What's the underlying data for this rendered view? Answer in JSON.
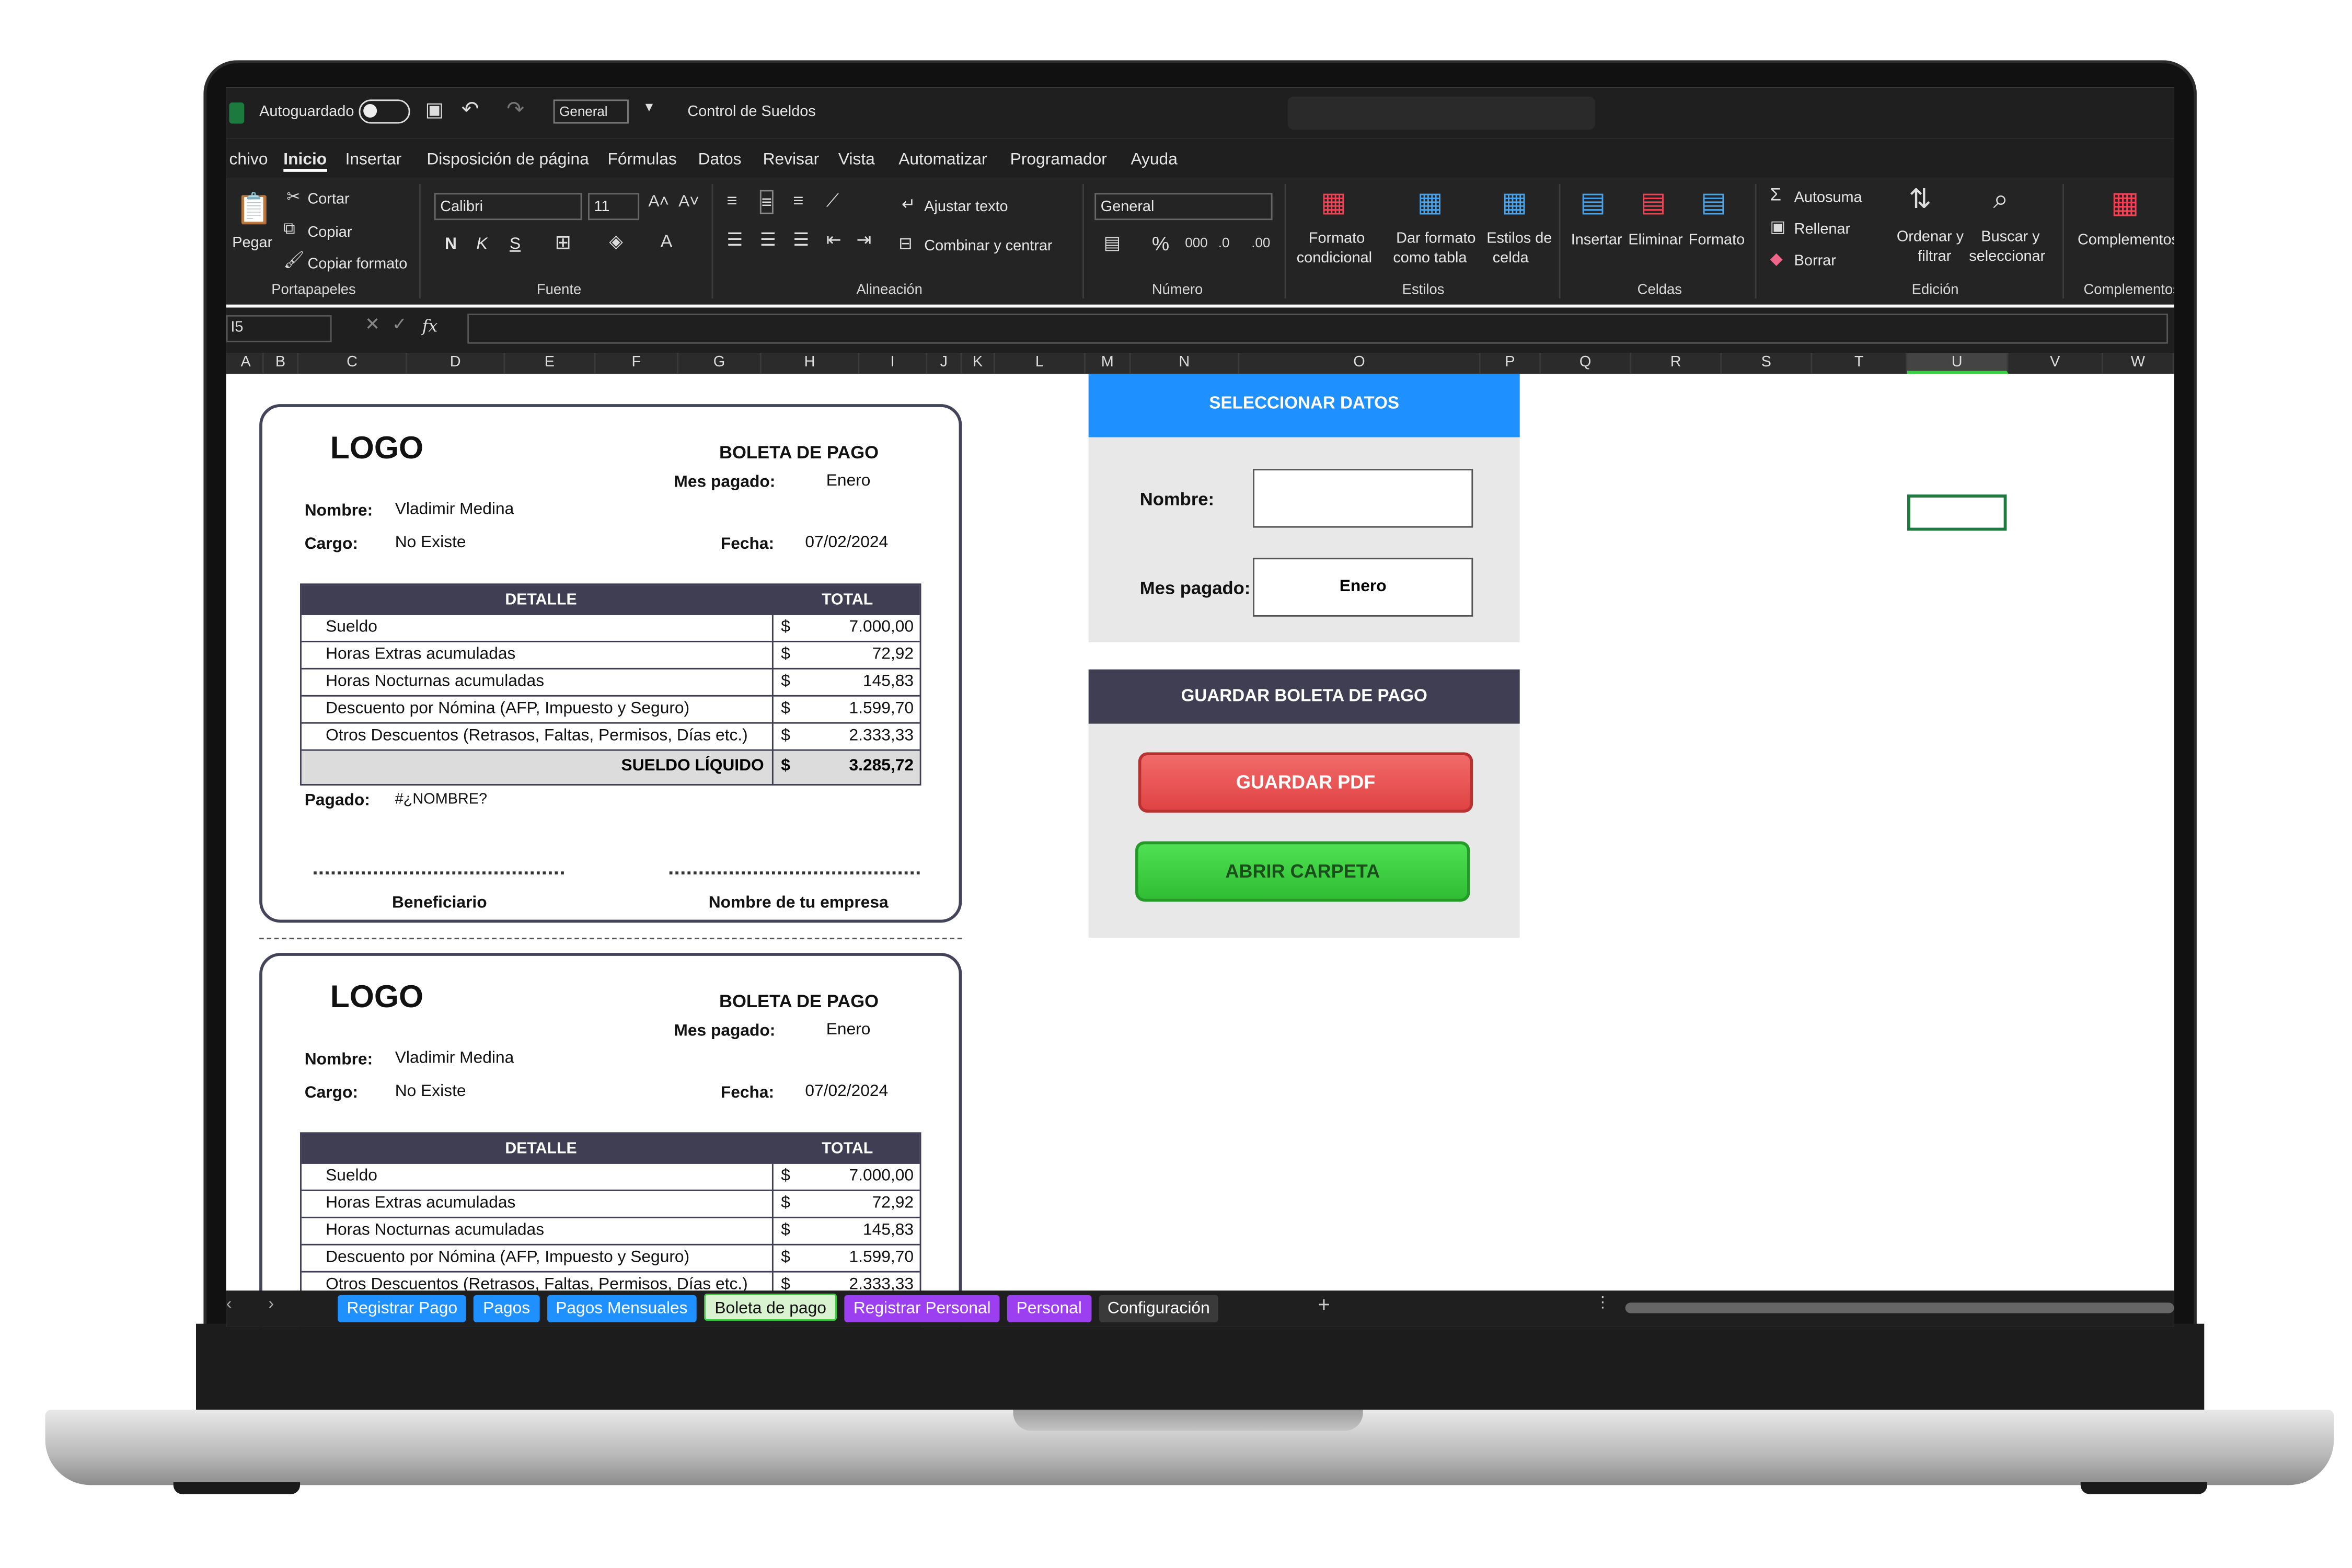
{
  "window": {
    "autosave_label": "Autoguardado",
    "number_format_quick": "General",
    "file_title": "Control de Sueldos"
  },
  "menu": [
    "chivo",
    "Inicio",
    "Insertar",
    "Disposición de página",
    "Fórmulas",
    "Datos",
    "Revisar",
    "Vista",
    "Automatizar",
    "Programador",
    "Ayuda"
  ],
  "ribbon": {
    "clipboard": {
      "paste": "Pegar",
      "cut": "Cortar",
      "copy": "Copiar",
      "format_painter": "Copiar formato",
      "group": "Portapapeles"
    },
    "font": {
      "family": "Calibri",
      "size": "11",
      "bold": "N",
      "italic": "K",
      "underline": "S",
      "group": "Fuente"
    },
    "alignment": {
      "wrap": "Ajustar texto",
      "merge": "Combinar y centrar",
      "group": "Alineación"
    },
    "number": {
      "format": "General",
      "group": "Número"
    },
    "styles": {
      "cond_format_1": "Formato",
      "cond_format_2": "condicional",
      "table_1": "Dar formato",
      "table_2": "como tabla",
      "cell_1": "Estilos de",
      "cell_2": "celda",
      "group": "Estilos"
    },
    "cells": {
      "insert": "Insertar",
      "delete": "Eliminar",
      "format": "Formato",
      "group": "Celdas"
    },
    "editing": {
      "autosum": "Autosuma",
      "fill": "Rellenar",
      "clear": "Borrar",
      "sort_1": "Ordenar y",
      "sort_2": "filtrar",
      "find_1": "Buscar y",
      "find_2": "seleccionar",
      "group": "Edición"
    },
    "addins": {
      "label": "Complementos",
      "group": "Complementos"
    }
  },
  "formula_bar": {
    "name_box": "I5",
    "fx": "fx",
    "value": ""
  },
  "columns": [
    "A",
    "B",
    "C",
    "D",
    "E",
    "F",
    "G",
    "H",
    "I",
    "J",
    "K",
    "L",
    "M",
    "N",
    "O",
    "P",
    "Q",
    "R",
    "S",
    "T",
    "U",
    "V",
    "W"
  ],
  "receipt": {
    "logo": "LOGO",
    "title": "BOLETA DE PAGO",
    "month_label": "Mes pagado:",
    "month": "Enero",
    "name_label": "Nombre:",
    "name": "Vladimir Medina",
    "role_label": "Cargo:",
    "role": "No Existe",
    "date_label": "Fecha:",
    "date": "07/02/2024",
    "col_detail": "DETALLE",
    "col_total": "TOTAL",
    "currency": "$",
    "items": [
      {
        "label": "Sueldo",
        "amount": "7.000,00"
      },
      {
        "label": "Horas Extras acumuladas",
        "amount": "72,92"
      },
      {
        "label": "Horas Nocturnas acumuladas",
        "amount": "145,83"
      },
      {
        "label": "Descuento por Nómina (AFP, Impuesto y Seguro)",
        "amount": "1.599,70"
      },
      {
        "label": "Otros Descuentos (Retrasos, Faltas, Permisos, Días etc.)",
        "amount": "2.333,33"
      }
    ],
    "total_label": "SUELDO LÍQUIDO",
    "total": "3.285,72",
    "paid_label": "Pagado:",
    "paid_value": "#¿NOMBRE?",
    "sign_left": "Beneficiario",
    "sign_right": "Nombre de tu empresa"
  },
  "panel": {
    "select_title": "SELECCIONAR DATOS",
    "name_label": "Nombre:",
    "name_value": "",
    "month_label": "Mes pagado:",
    "month_value": "Enero",
    "save_title": "GUARDAR BOLETA DE PAGO",
    "pdf_button": "GUARDAR PDF",
    "folder_button": "ABRIR CARPETA"
  },
  "tabs": [
    {
      "label": "Registrar Pago",
      "color": "#1e90ff"
    },
    {
      "label": "Pagos",
      "color": "#1e90ff"
    },
    {
      "label": "Pagos Mensuales",
      "color": "#1e90ff"
    },
    {
      "label": "Boleta de pago",
      "color": "#d9f2d0",
      "active": true
    },
    {
      "label": "Registrar Personal",
      "color": "#9b3ff0"
    },
    {
      "label": "Personal",
      "color": "#9b3ff0"
    },
    {
      "label": "Configuración",
      "color": "#3a3a3a"
    }
  ],
  "colors": {
    "accent_blue": "#1e90ff",
    "header_dark": "#3f3e52",
    "pdf_red": "#ef5350",
    "folder_green": "#3ad13e",
    "panel_grey": "#e8e8e8"
  }
}
